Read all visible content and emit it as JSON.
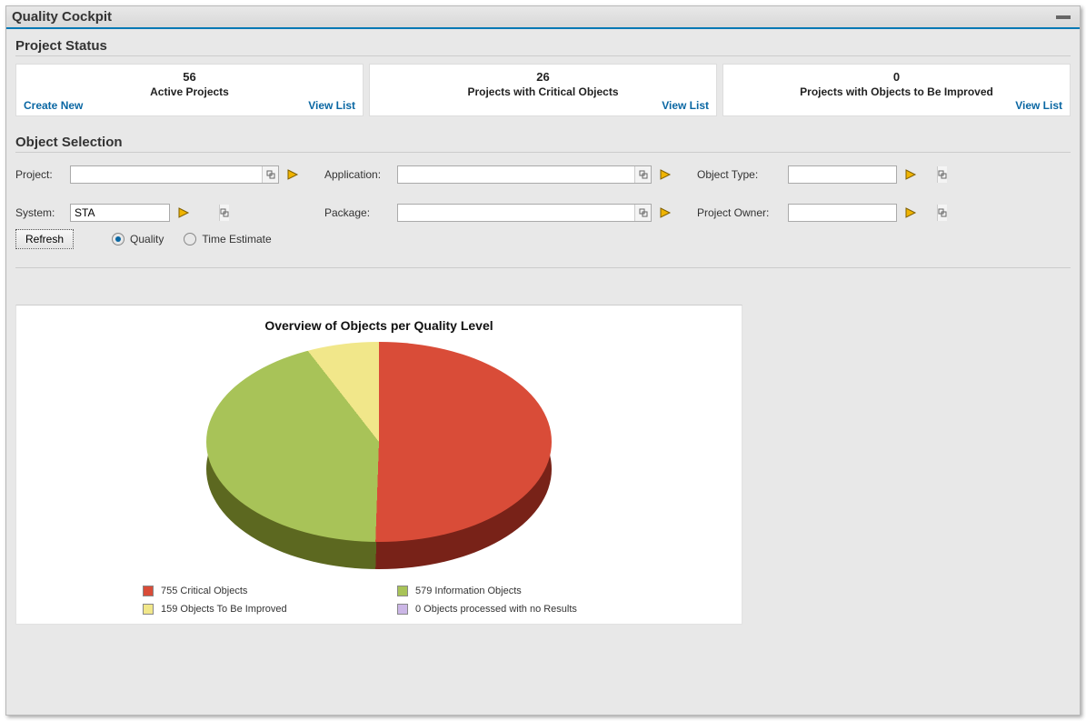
{
  "window": {
    "title": "Quality Cockpit"
  },
  "project_status": {
    "heading": "Project Status",
    "cards": [
      {
        "count": "56",
        "label": "Active Projects",
        "left_link": "Create New",
        "right_link": "View List"
      },
      {
        "count": "26",
        "label": "Projects with Critical Objects",
        "left_link": "",
        "right_link": "View List"
      },
      {
        "count": "0",
        "label": "Projects with Objects to Be Improved",
        "left_link": "",
        "right_link": "View List"
      }
    ]
  },
  "object_selection": {
    "heading": "Object Selection",
    "labels": {
      "project": "Project:",
      "application": "Application:",
      "object_type": "Object Type:",
      "system": "System:",
      "package": "Package:",
      "project_owner": "Project Owner:"
    },
    "values": {
      "project": "",
      "application": "",
      "object_type": "",
      "system": "STA",
      "package": "",
      "project_owner": ""
    },
    "refresh_label": "Refresh",
    "radio": {
      "quality": "Quality",
      "time_estimate": "Time Estimate",
      "selected": "quality"
    }
  },
  "chart_data": {
    "type": "pie",
    "title": "Overview of Objects per Quality Level",
    "series": [
      {
        "name": "Critical Objects",
        "value": 755,
        "color": "#d94c38"
      },
      {
        "name": "Information Objects",
        "value": 579,
        "color": "#a8c358"
      },
      {
        "name": "Objects To Be Improved",
        "value": 159,
        "color": "#f1e78a"
      },
      {
        "name": "Objects processed with no Results",
        "value": 0,
        "color": "#cbb6e6"
      }
    ]
  },
  "legend": {
    "items": [
      {
        "text": "755  Critical Objects",
        "color": "#d94c38"
      },
      {
        "text": "579  Information Objects",
        "color": "#a8c358"
      },
      {
        "text": "159  Objects To Be Improved",
        "color": "#f1e78a"
      },
      {
        "text": "0  Objects processed with no Results",
        "color": "#cbb6e6"
      }
    ]
  }
}
